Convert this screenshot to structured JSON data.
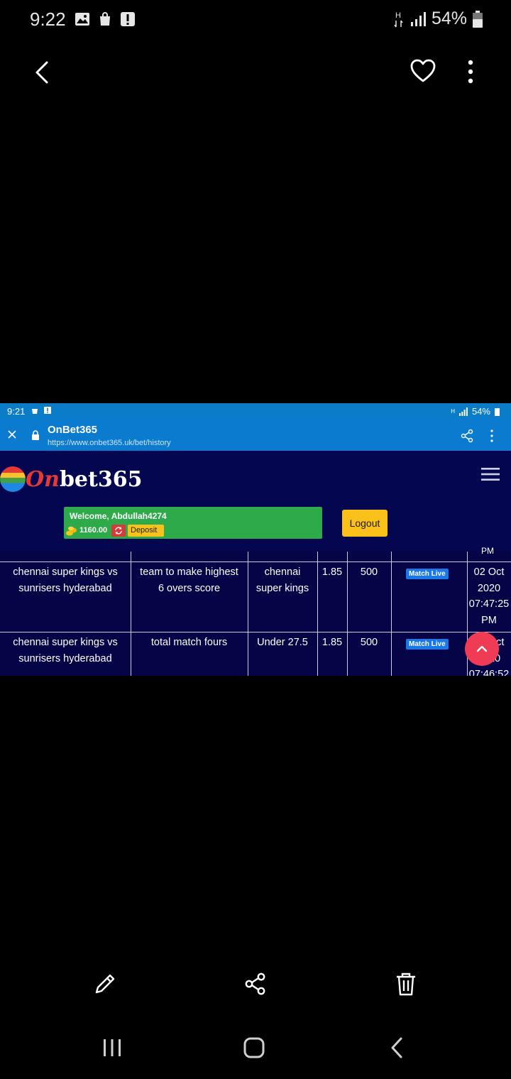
{
  "status_bar": {
    "time": "9:22",
    "battery": "54%",
    "network": "H"
  },
  "gallery": {
    "icons": [
      "back-icon",
      "heart-icon",
      "more-icon",
      "edit-icon",
      "share-icon",
      "delete-icon"
    ]
  },
  "screenshot": {
    "status_bar": {
      "time": "9:21",
      "battery": "54%",
      "network": "H"
    },
    "browser": {
      "title": "OnBet365",
      "url": "https://www.onbet365.uk/bet/history"
    },
    "site": {
      "logo": {
        "part1": "On",
        "part2": "bet365"
      },
      "welcome": "Welcome, Abdullah4274",
      "balance": "1160.00",
      "deposit_label": "Deposit",
      "logout_label": "Logout"
    },
    "table": {
      "partial_top_text": "PM",
      "rows": [
        {
          "match": [
            "chennai super kings vs",
            "sunrisers hyderabad"
          ],
          "market": [
            "team to make highest",
            "6 overs score"
          ],
          "selection": [
            "chennai",
            "super kings"
          ],
          "odds": "1.85",
          "stake": "500",
          "status": "Match Live",
          "date": [
            "02 Oct",
            "2020",
            "07:47:25",
            "PM"
          ]
        },
        {
          "match": [
            "chennai super kings vs",
            "sunrisers hyderabad"
          ],
          "market": [
            "total match fours"
          ],
          "selection": [
            "Under 27.5"
          ],
          "odds": "1.85",
          "stake": "500",
          "status": "Match Live",
          "date": [
            "02 Oct",
            "2020",
            "07:46:52"
          ]
        }
      ]
    }
  },
  "colors": {
    "site_bg": "#050650",
    "browser_bar": "#0b7bd0",
    "welcome_green": "#2faa4a",
    "logout_yellow": "#f9c11a",
    "badge_blue": "#1b78e8",
    "fab_red": "#f03b55"
  }
}
